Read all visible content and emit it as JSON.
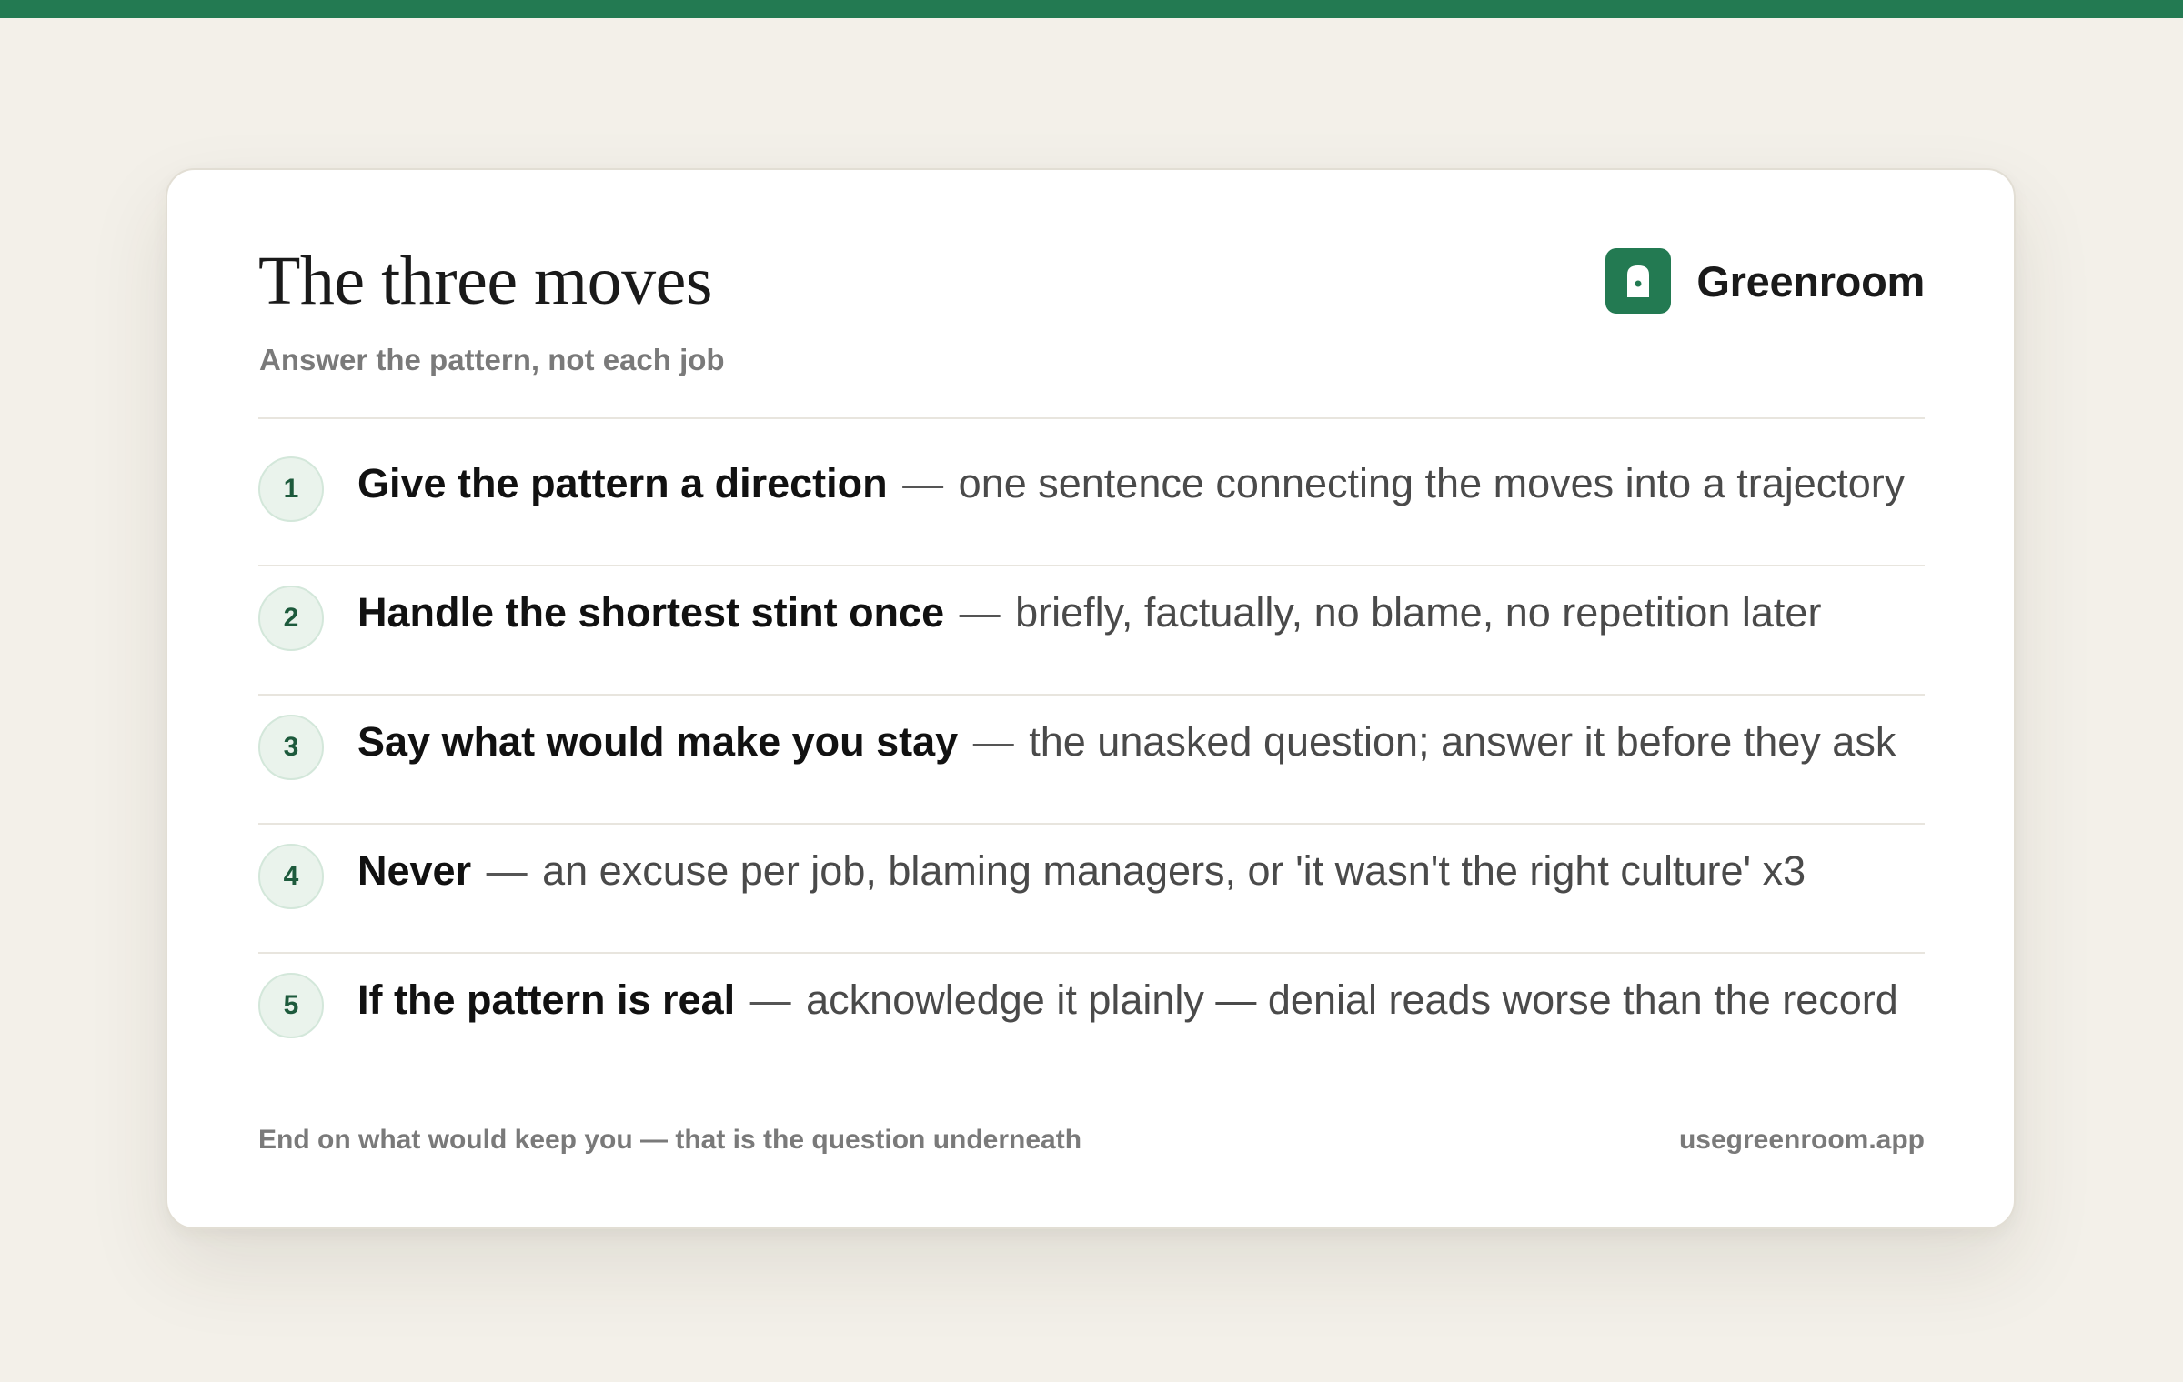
{
  "header": {
    "title": "The three moves",
    "subtitle": "Answer the pattern, not each job"
  },
  "brand": {
    "name": "Greenroom",
    "icon": "door-icon",
    "color": "#237a52"
  },
  "moves": [
    {
      "number": "1",
      "headline": "Give the pattern a direction",
      "detail": "one sentence connecting the moves into a trajectory"
    },
    {
      "number": "2",
      "headline": "Handle the shortest stint once",
      "detail": "briefly, factually, no blame, no repetition later"
    },
    {
      "number": "3",
      "headline": "Say what would make you stay",
      "detail": "the unasked question; answer it before they ask"
    },
    {
      "number": "4",
      "headline": "Never",
      "detail": "an excuse per job, blaming managers, or 'it wasn't the right culture' x3"
    },
    {
      "number": "5",
      "headline": "If the pattern is real",
      "detail": "acknowledge it plainly — denial reads worse than the record"
    }
  ],
  "separator": "—",
  "footer": {
    "note": "End on what would keep you — that is the question underneath",
    "site": "usegreenroom.app"
  },
  "colors": {
    "accent": "#237a52",
    "background": "#f3f0e9",
    "card": "#ffffff"
  }
}
